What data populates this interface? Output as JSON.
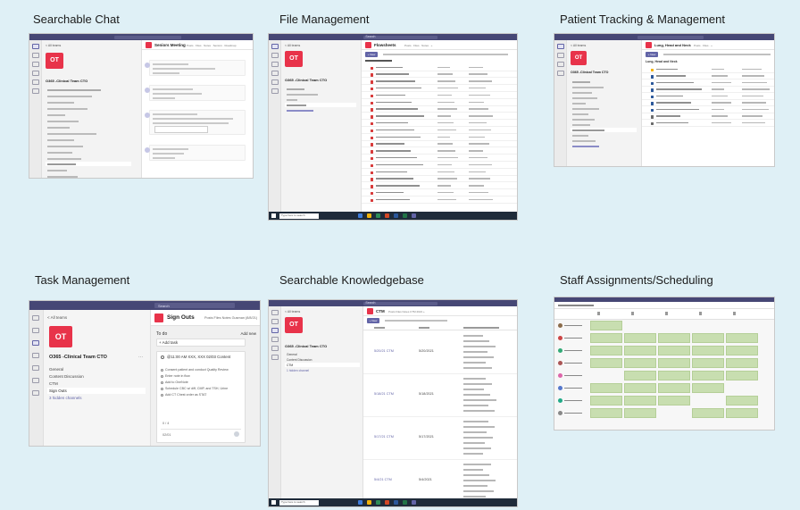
{
  "panels": {
    "searchable_chat": {
      "title": "Searchable Chat",
      "team": "O365 -Clinical Team CTO",
      "logo": "OT",
      "meeting_title": "Seniors Meeting",
      "back": "< All teams"
    },
    "file_management": {
      "title": "File Management",
      "team": "O365 -Clinical Team CTO",
      "logo": "OT",
      "folder_title": "Flowsheets",
      "search": "Search",
      "taskbar_search": "Type here to search",
      "back": "< All teams"
    },
    "patient_tracking": {
      "title": "Patient Tracking & Management",
      "team": "O365 -Clinical Team CTO",
      "logo": "OT",
      "list_title": "Lung, Head and Neck",
      "breadcrumb": "Lung, Head and Neck",
      "new_button": "+ New",
      "back": "< All teams"
    },
    "task_management": {
      "title": "Task Management",
      "team": "O365 -Clinical Team CTO",
      "logo": "OT",
      "board_title": "Sign Outs",
      "tabs": "Posts  Files  Notes  Gusman (8/8/21)",
      "search": "Search",
      "back": "< All teams",
      "channels": [
        "General",
        "Content Discussion",
        "CTM",
        "Sign Outs",
        "3 hidden channels"
      ],
      "todo_label": "To do",
      "add_task": "+  Add task",
      "add_new": "Add new",
      "task_title": "@11:00 AM XXX, XXX 02/03 Content",
      "task_items": [
        "Consent patient and conduct Quality Review",
        "Enter note in flow",
        "Add to OneNote",
        "Schedule CBC w/ diff, CMP, and TSH, Urine",
        "Add CT Chest order as STAT"
      ],
      "task_progress": "0 / 4",
      "task_date": "02/01"
    },
    "knowledgebase": {
      "title": "Searchable Knowledgebase",
      "team": "O365 -Clinical Team CTO",
      "logo": "OT",
      "channel": "CTM",
      "tabs": "Posts  Files  Notes  CTM 2021  +",
      "new_button": "+ New",
      "channels": [
        "General",
        "Content Discussion",
        "CTM",
        "1 hidden channel"
      ],
      "search": "Search",
      "taskbar_search": "Type here to search",
      "back": "< All teams",
      "rows": [
        {
          "title": "5/20/21 CTM",
          "date": "5/20/2021"
        },
        {
          "title": "5/18/21 CTM",
          "date": "5/18/2021"
        },
        {
          "title": "5/17/21 CTM",
          "date": "5/17/2021"
        },
        {
          "title": "5/4/21 CTM",
          "date": "5/4/2021"
        }
      ]
    },
    "staff_scheduling": {
      "title": "Staff Assignments/Scheduling"
    }
  },
  "colors": {
    "background": "#dff0f6",
    "teams_header": "#464775",
    "teams_accent": "#6264a7",
    "team_logo": "#e8334a",
    "shift_green": "#c8deb0"
  }
}
